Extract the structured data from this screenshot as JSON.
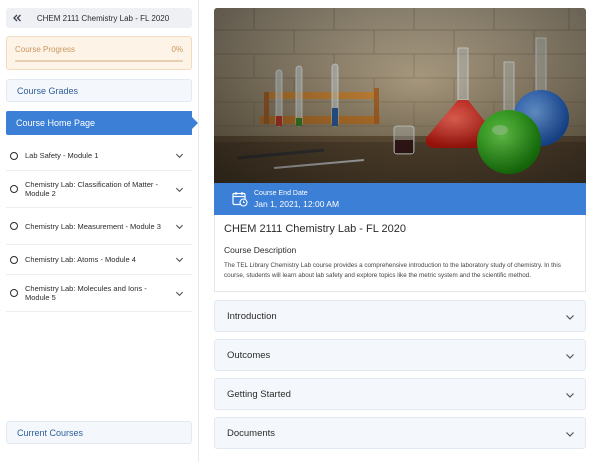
{
  "sidebar": {
    "title": "CHEM 2111 Chemistry Lab - FL 2020",
    "collapse_icon": "double-chevron-left-icon",
    "progress": {
      "label": "Course Progress",
      "percent_text": "0%",
      "value": 0
    },
    "grades_label": "Course Grades",
    "home_label": "Course Home Page",
    "modules": [
      {
        "label": "Lab Safety - Module 1"
      },
      {
        "label": "Chemistry Lab: Classification of Matter - Module 2"
      },
      {
        "label": "Chemistry Lab: Measurement - Module 3"
      },
      {
        "label": "Chemistry Lab: Atoms - Module 4"
      },
      {
        "label": "Chemistry Lab: Molecules and Ions - Module 5"
      }
    ],
    "current_courses_label": "Current Courses"
  },
  "main": {
    "end_date_label": "Course End Date",
    "end_date_value": "Jan 1, 2021, 12:00 AM",
    "course_title": "CHEM 2111 Chemistry Lab - FL 2020",
    "description_heading": "Course Description",
    "description_text": "The TEL Library Chemistry Lab course provides a comprehensive introduction to the laboratory study of chemistry. In this course, students will learn about lab safety and explore topics like the metric system and the scientific method.",
    "accordions": [
      {
        "label": "Introduction"
      },
      {
        "label": "Outcomes"
      },
      {
        "label": "Getting Started"
      },
      {
        "label": "Documents"
      }
    ]
  },
  "colors": {
    "accent": "#3b7fd6",
    "progress_bg": "#fdf3e7",
    "progress_text": "#c99760",
    "nav_text": "#2f5f9b"
  }
}
